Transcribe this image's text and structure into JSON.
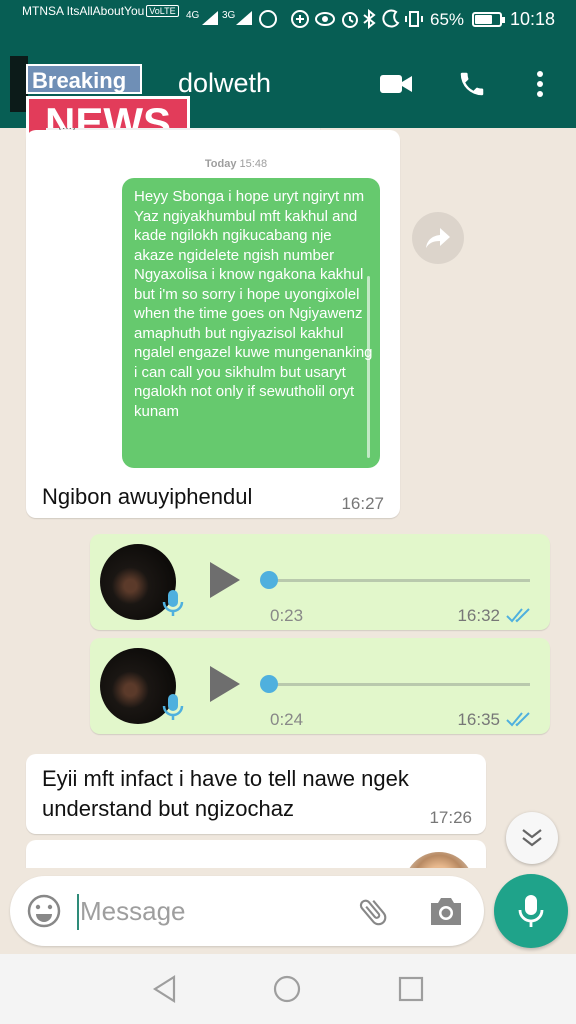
{
  "status_bar": {
    "carrier": "MTNSA ItsAllAboutYou",
    "volte": "VoLTE",
    "network_1": "4G",
    "network_2": "3G",
    "battery": "65%",
    "battery_level": 0.65,
    "time": "10:18"
  },
  "header": {
    "contact_name": "dolweth",
    "overlay_breaking": "Breaking",
    "overlay_news": "NEWS"
  },
  "chat": {
    "previous_stub": "(...)",
    "date_separator": {
      "day": "Today",
      "time": "15:48"
    },
    "reply": {
      "quoted_text": "Heyy Sbonga i hope uryt ngiryt nm Yaz ngiyakhumbul mft kakhul and kade ngilokh ngikucabang nje  akaze ngidelete ngish number Ngyaxolisa i know ngakona kakhul but i'm so sorry i hope uyongixolel when the time goes on Ngiyawenz amaphuth but ngiyazisol kakhul ngalel engazel kuwe  mungenanking i can call you sikhulm but usaryt ngalokh not only if sewutholil oryt kunam",
      "text": "Ngibon awuyiphendul",
      "time": "16:27"
    },
    "voice_notes": [
      {
        "duration": "0:23",
        "time": "16:32"
      },
      {
        "duration": "0:24",
        "time": "16:35"
      }
    ],
    "message_2": {
      "text": "Eyii mft infact i have to tell nawe ngek understand but ngizochaz",
      "time": "17:26"
    }
  },
  "input": {
    "placeholder": "Message"
  },
  "colors": {
    "header": "#075e54",
    "outgoing_bubble": "#e2f7cb",
    "incoming_bubble": "#ffffff",
    "quote_bubble": "#66c96e",
    "accent": "#1fa38a",
    "read_ticks": "#4fb0de"
  },
  "icons": [
    "back-icon",
    "video-call-icon",
    "phone-icon",
    "more-options-icon",
    "forward-icon",
    "play-icon",
    "mic-badge-icon",
    "read-ticks-icon",
    "scroll-down-icon",
    "emoji-icon",
    "attach-icon",
    "camera-icon",
    "mic-icon",
    "nav-back-icon",
    "nav-home-icon",
    "nav-recents-icon"
  ]
}
